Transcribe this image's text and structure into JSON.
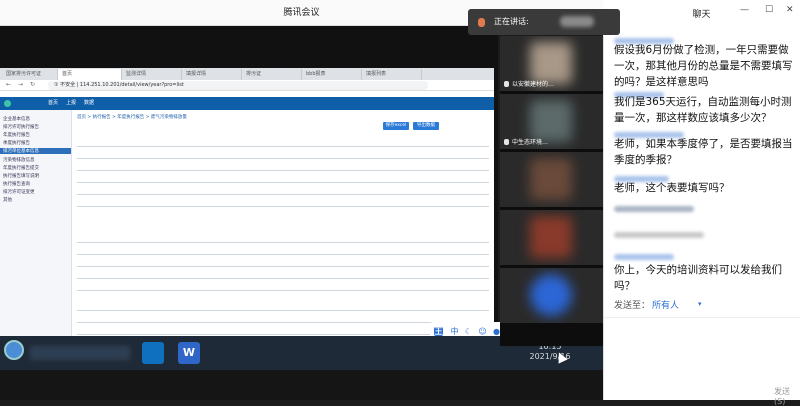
{
  "window": {
    "title": "腾讯会议",
    "chat_title": "聊天",
    "speaking_label": "正在讲话:"
  },
  "browser": {
    "tabs": [
      "国家排污许可证",
      "首页",
      "监测详情",
      "填报详情",
      "排污证",
      "bbb报表",
      "填报列表"
    ],
    "url": "① 不安全 | 114.251.10.201/detail/view/year?pro=list"
  },
  "site": {
    "nav": [
      "首页",
      "上报",
      "数据"
    ],
    "sidebar": [
      "企业基本信息",
      "排污许可执行报告",
      "年度执行报告",
      "季度执行报告",
      "排污单位基本信息",
      "污染物排放信息",
      "年度执行报告提交",
      "执行报告填写说明",
      "执行报告查询",
      "排污许可证变更",
      "其他"
    ],
    "breadcrumb": "首页 > 执行报告 > 年度执行报告 > 废气污染物排放量",
    "buttons": [
      "保存excel",
      "导出数据"
    ]
  },
  "video_tiles": [
    {
      "name": "以安徽建材的…",
      "color": "#a89888"
    },
    {
      "name": "中生态环境…",
      "color": "#5c6a6a"
    },
    {
      "name": "",
      "color": "#6a4a3a"
    },
    {
      "name": "",
      "color": "#8a3a2a"
    },
    {
      "name": "",
      "color": "#2c66d6"
    }
  ],
  "chat": {
    "messages": [
      "假设我6月份做了检测，一年只需要做一次，那其他月份的总量是不需要填写的吗？是这样意思吗",
      "我们是365天运行，自动监测每小时测量一次，那这样数应该填多少次？",
      "老师，如果本季度停了，是否要填报当季度的季报？",
      "老师，这个表要填写吗？",
      "你上，今天的培训资料可以发给我们吗？"
    ],
    "send_to_label": "发送至：",
    "send_to_value": "所有人",
    "send_button": "发送(S)"
  },
  "taskbar": {
    "time": "10:15",
    "date": "2021/9/16"
  }
}
